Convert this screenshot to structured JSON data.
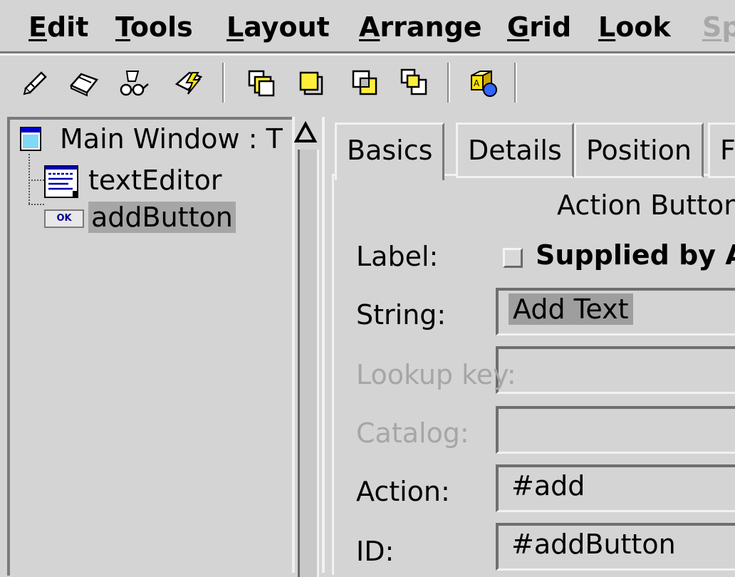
{
  "menu": {
    "items": [
      {
        "mnemonic": "E",
        "rest": "dit"
      },
      {
        "mnemonic": "T",
        "rest": "ools"
      },
      {
        "mnemonic": "L",
        "rest": "ayout"
      },
      {
        "mnemonic": "A",
        "rest": "rrange"
      },
      {
        "mnemonic": "G",
        "rest": "rid"
      },
      {
        "mnemonic": "L",
        "rest": "ook"
      },
      {
        "mnemonic": "S",
        "rest": "p"
      }
    ]
  },
  "toolbar": {
    "icons": [
      "check-pencil-icon",
      "eraser-icon",
      "glasses-icon",
      "lightning-icon",
      "bring-forward-icon",
      "bring-to-front-icon",
      "send-backward-icon",
      "send-to-back-icon",
      "shapes-icon"
    ]
  },
  "tree": {
    "root_label": "Main Window : T",
    "children": [
      {
        "label": "textEditor",
        "icon": "text-editor-icon"
      },
      {
        "label": "addButton",
        "icon": "action-button-icon",
        "icon_text": "OK",
        "selected": true
      }
    ]
  },
  "scrollbar": {
    "up_arrow": "Δ"
  },
  "tabs": [
    {
      "label": "Basics",
      "active": true
    },
    {
      "label": "Details",
      "active": false
    },
    {
      "label": "Position",
      "active": false
    },
    {
      "label": "F",
      "active": false
    }
  ],
  "form": {
    "section_title": "Action Button",
    "label_field": {
      "label": "Label:",
      "checkbox_text": "Supplied by A",
      "checked": false
    },
    "string_field": {
      "label": "String:",
      "value": "Add Text"
    },
    "lookup_field": {
      "label": "Lookup key:",
      "value": ""
    },
    "catalog_field": {
      "label": "Catalog:",
      "value": ""
    },
    "action_field": {
      "label": "Action:",
      "value": "#add"
    },
    "id_field": {
      "label": "ID:",
      "value": "#addButton"
    }
  }
}
